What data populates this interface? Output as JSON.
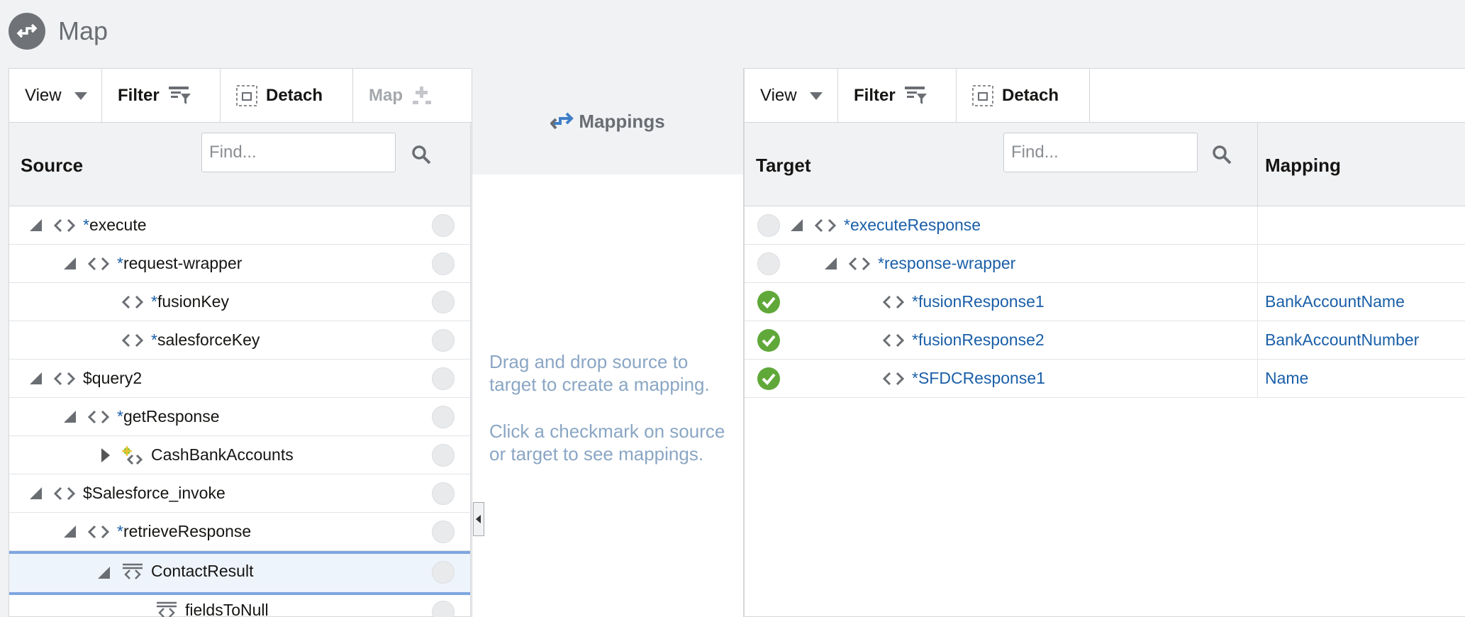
{
  "header": {
    "title": "Map"
  },
  "source": {
    "toolbar": {
      "view": "View",
      "filter": "Filter",
      "detach": "Detach",
      "map": "Map"
    },
    "column_title": "Source",
    "find_placeholder": "Find...",
    "rows": [
      {
        "star": "*",
        "label": "execute"
      },
      {
        "star": "*",
        "label": "request-wrapper"
      },
      {
        "star": "*",
        "label": "fusionKey"
      },
      {
        "star": "*",
        "label": "salesforceKey"
      },
      {
        "star": "",
        "label": "$query2"
      },
      {
        "star": "*",
        "label": "getResponse"
      },
      {
        "star": "",
        "label": "CashBankAccounts"
      },
      {
        "star": "",
        "label": "$Salesforce_invoke"
      },
      {
        "star": "*",
        "label": "retrieveResponse"
      },
      {
        "star": "",
        "label": "ContactResult"
      },
      {
        "star": "",
        "label": "fieldsToNull"
      }
    ]
  },
  "mappings": {
    "title": "Mappings",
    "hint1": "Drag and drop source to target to create a mapping.",
    "hint2": "Click a checkmark on source or target to see mappings."
  },
  "target": {
    "toolbar": {
      "view": "View",
      "filter": "Filter",
      "detach": "Detach"
    },
    "column_title": "Target",
    "mapping_column_title": "Mapping",
    "find_placeholder": "Find...",
    "rows": [
      {
        "star": "*",
        "label": "executeResponse",
        "mapping": "",
        "mapped": false
      },
      {
        "star": "*",
        "label": "response-wrapper",
        "mapping": "",
        "mapped": false
      },
      {
        "star": "*",
        "label": "fusionResponse1",
        "mapping": "BankAccountName",
        "mapped": true
      },
      {
        "star": "*",
        "label": "fusionResponse2",
        "mapping": "BankAccountNumber",
        "mapped": true
      },
      {
        "star": "*",
        "label": "SFDCResponse1",
        "mapping": "Name",
        "mapped": true
      }
    ]
  },
  "colors": {
    "accent": "#1a5fa8",
    "check": "#5fa839",
    "mapping_hint": "#8aa6c4"
  }
}
